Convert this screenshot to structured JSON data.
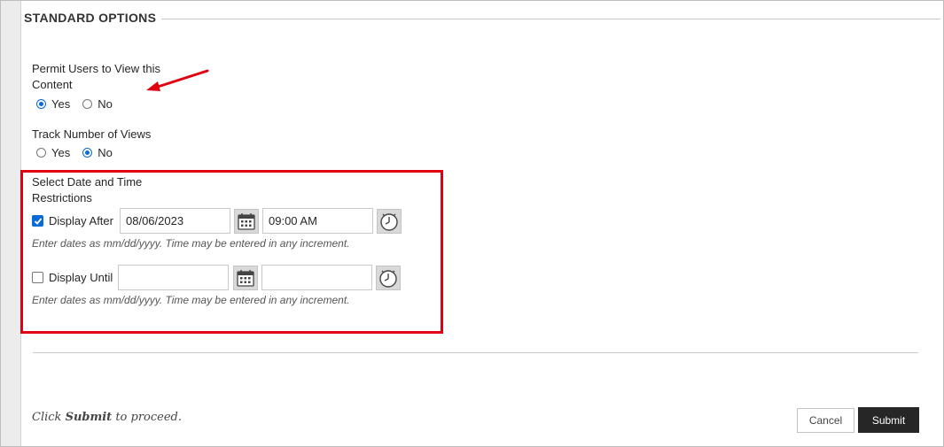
{
  "section": {
    "title": "STANDARD OPTIONS"
  },
  "permit": {
    "label_line1": "Permit Users to View this",
    "label_line2": "Content",
    "yes": "Yes",
    "no": "No",
    "selected": "Yes"
  },
  "track": {
    "label": "Track Number of Views",
    "yes": "Yes",
    "no": "No",
    "selected": "No"
  },
  "restrictions": {
    "label_line1": "Select Date and Time",
    "label_line2": "Restrictions",
    "display_after": {
      "label": "Display After",
      "checked": true,
      "date": "08/06/2023",
      "time": "09:00 AM",
      "hint": "Enter dates as mm/dd/yyyy. Time may be entered in any increment."
    },
    "display_until": {
      "label": "Display Until",
      "checked": false,
      "date": "",
      "time": "",
      "hint": "Enter dates as mm/dd/yyyy. Time may be entered in any increment."
    }
  },
  "footer": {
    "instruction_prefix": "Click ",
    "instruction_bold": "Submit",
    "instruction_suffix": " to proceed.",
    "cancel_label": "Cancel",
    "submit_label": "Submit"
  },
  "colors": {
    "highlight": "#e00012",
    "radio_accent": "#0a6ad6",
    "submit_bg": "#262626"
  },
  "icons": [
    "calendar-icon",
    "clock-icon",
    "annotation-arrow"
  ]
}
